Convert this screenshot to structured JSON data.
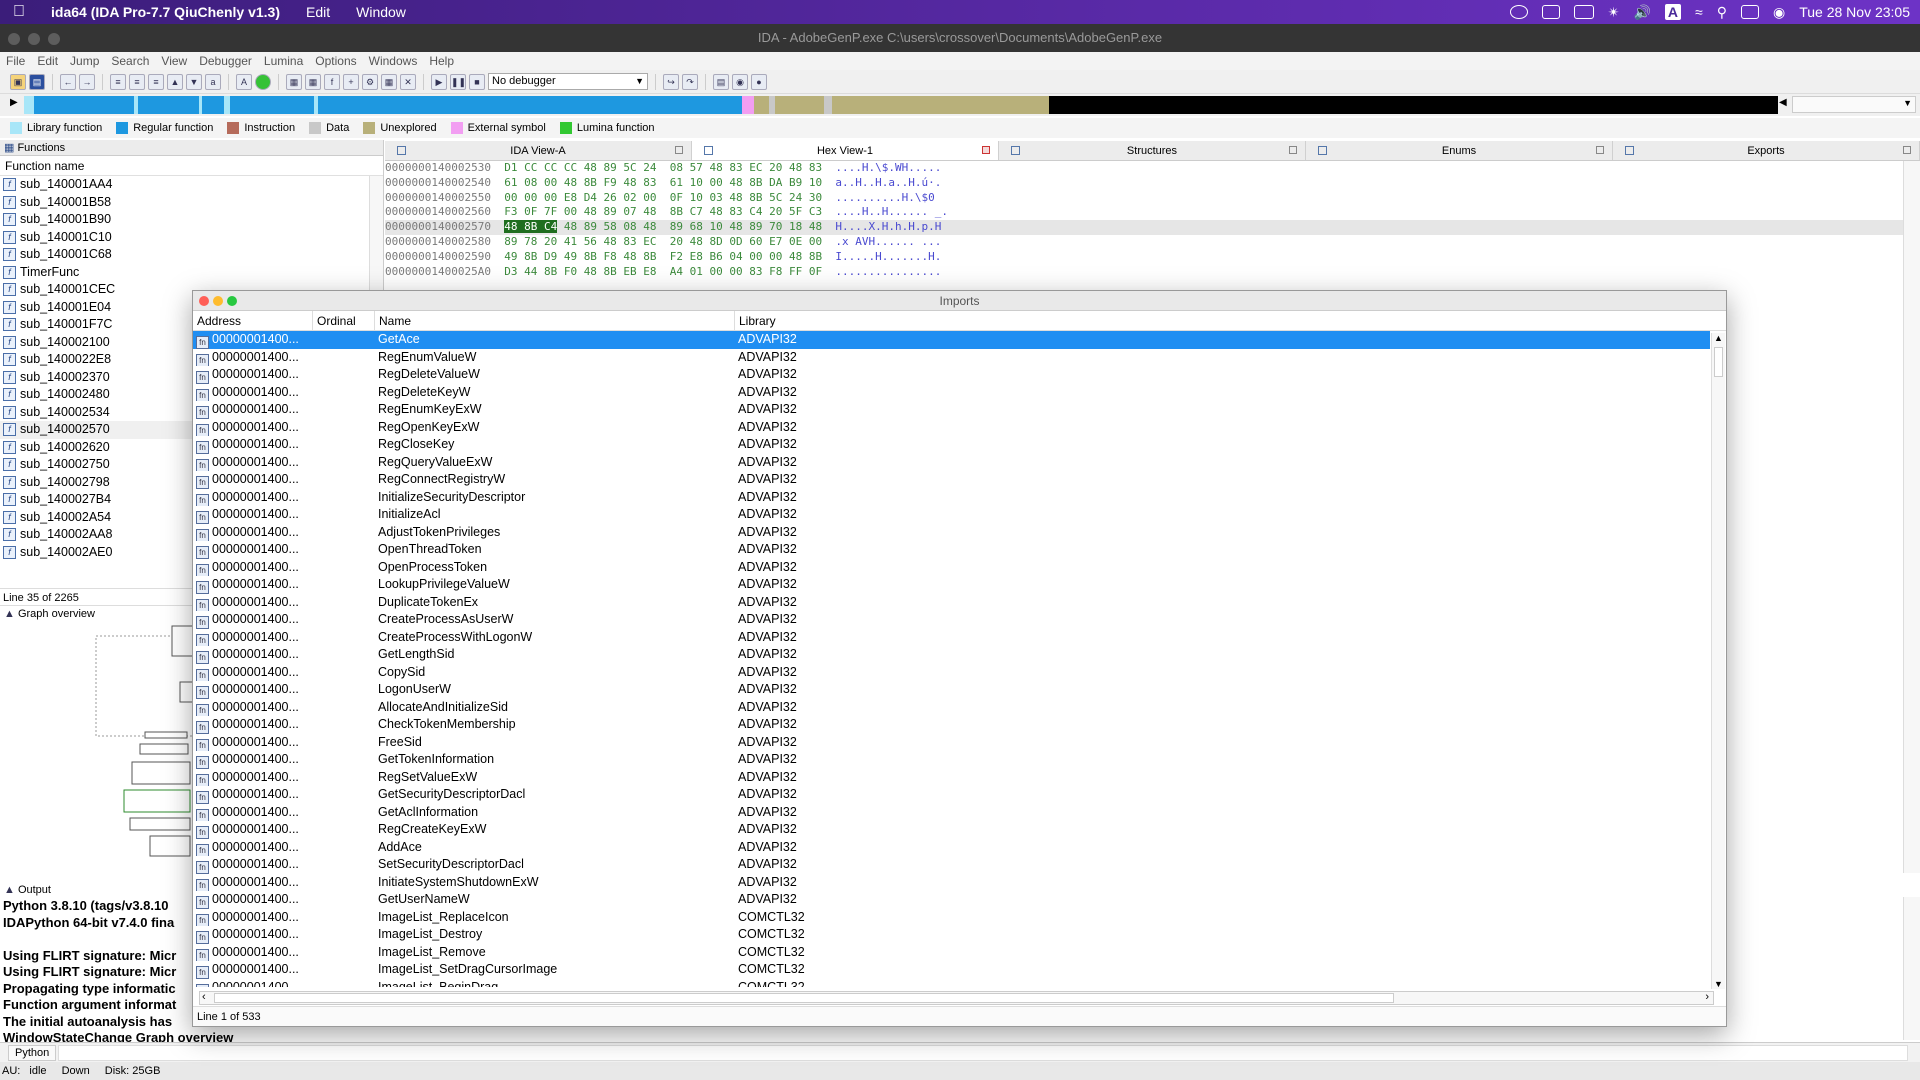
{
  "macbar": {
    "app": "ida64 (IDA Pro-7.7 QiuChenly v1.3)",
    "menus": [
      "Edit",
      "Window"
    ],
    "clock": "Tue 28 Nov  23:05"
  },
  "window": {
    "title": "IDA - AdobeGenP.exe C:\\users\\crossover\\Documents\\AdobeGenP.exe"
  },
  "menubar": [
    "File",
    "Edit",
    "Jump",
    "Search",
    "View",
    "Debugger",
    "Lumina",
    "Options",
    "Windows",
    "Help"
  ],
  "toolbar": {
    "debugger_select": "No debugger"
  },
  "legend": [
    {
      "label": "Library function",
      "color": "#a8e6f8"
    },
    {
      "label": "Regular function",
      "color": "#1e98e0"
    },
    {
      "label": "Instruction",
      "color": "#b56b5b"
    },
    {
      "label": "Data",
      "color": "#c8c8c8"
    },
    {
      "label": "Unexplored",
      "color": "#b8b07a"
    },
    {
      "label": "External symbol",
      "color": "#f29ef2"
    },
    {
      "label": "Lumina function",
      "color": "#32c832"
    }
  ],
  "functions": {
    "title": "Functions",
    "column": "Function name",
    "items": [
      "sub_140001AA4",
      "sub_140001B58",
      "sub_140001B90",
      "sub_140001C10",
      "sub_140001C68",
      "TimerFunc",
      "sub_140001CEC",
      "sub_140001E04",
      "sub_140001F7C",
      "sub_140002100",
      "sub_1400022E8",
      "sub_140002370",
      "sub_140002480",
      "sub_140002534",
      "sub_140002570",
      "sub_140002620",
      "sub_140002750",
      "sub_140002798",
      "sub_1400027B4",
      "sub_140002A54",
      "sub_140002AA8",
      "sub_140002AE0"
    ],
    "status": "Line 35 of 2265",
    "graph_title": "Graph overview"
  },
  "tabs": [
    {
      "label": "IDA View-A",
      "active": false
    },
    {
      "label": "Hex View-1",
      "active": true
    },
    {
      "label": "Structures",
      "active": false
    },
    {
      "label": "Enums",
      "active": false
    },
    {
      "label": "Exports",
      "active": false
    }
  ],
  "hex": [
    {
      "addr": "0000000140002530",
      "a": "D1 CC CC CC 48 89 5C 24",
      "b": "08 57 48 83 EC 20 48 83",
      "asc": "....H.\\$.WH....."
    },
    {
      "addr": "0000000140002540",
      "a": "61 08 00 48 8B F9 48 83",
      "b": "61 10 00 48 8B DA B9 10",
      "asc": "a..H..H.a..H.ú·."
    },
    {
      "addr": "0000000140002550",
      "a": "00 00 00 E8 D4 26 02 00",
      "b": "0F 10 03 48 8B 5C 24 30",
      "asc": "..........H.\\$0"
    },
    {
      "addr": "0000000140002560",
      "a": "F3 0F 7F 00 48 89 07 48",
      "b": "8B C7 48 83 C4 20 5F C3",
      "asc": "....H..H...... _."
    },
    {
      "addr": "0000000140002570",
      "a": "48 8B C4 48 89 58 08 48",
      "b": "89 68 10 48 89 70 18 48",
      "asc": "H....X.H.h.H.p.H",
      "sel": true
    },
    {
      "addr": "0000000140002580",
      "a": "89 78 20 41 56 48 83 EC",
      "b": "20 48 8D 0D 60 E7 0E 00",
      "asc": ".x AVH...... ..."
    },
    {
      "addr": "0000000140002590",
      "a": "49 8B D9 49 8B F8 48 8B",
      "b": "F2 E8 B6 04 00 00 48 8B",
      "asc": "I.....H.......H."
    },
    {
      "addr": "00000001400025A0",
      "a": "D3 44 8B F0 48 8B EB E8",
      "b": "A4 01 00 00 83 F8 FF 0F",
      "asc": "................"
    }
  ],
  "imports": {
    "title": "Imports",
    "columns": [
      "Address",
      "Ordinal",
      "Name",
      "Library"
    ],
    "addr_display": "00000001400...",
    "rows": [
      {
        "name": "GetAce",
        "lib": "ADVAPI32"
      },
      {
        "name": "RegEnumValueW",
        "lib": "ADVAPI32"
      },
      {
        "name": "RegDeleteValueW",
        "lib": "ADVAPI32"
      },
      {
        "name": "RegDeleteKeyW",
        "lib": "ADVAPI32"
      },
      {
        "name": "RegEnumKeyExW",
        "lib": "ADVAPI32"
      },
      {
        "name": "RegOpenKeyExW",
        "lib": "ADVAPI32"
      },
      {
        "name": "RegCloseKey",
        "lib": "ADVAPI32"
      },
      {
        "name": "RegQueryValueExW",
        "lib": "ADVAPI32"
      },
      {
        "name": "RegConnectRegistryW",
        "lib": "ADVAPI32"
      },
      {
        "name": "InitializeSecurityDescriptor",
        "lib": "ADVAPI32"
      },
      {
        "name": "InitializeAcl",
        "lib": "ADVAPI32"
      },
      {
        "name": "AdjustTokenPrivileges",
        "lib": "ADVAPI32"
      },
      {
        "name": "OpenThreadToken",
        "lib": "ADVAPI32"
      },
      {
        "name": "OpenProcessToken",
        "lib": "ADVAPI32"
      },
      {
        "name": "LookupPrivilegeValueW",
        "lib": "ADVAPI32"
      },
      {
        "name": "DuplicateTokenEx",
        "lib": "ADVAPI32"
      },
      {
        "name": "CreateProcessAsUserW",
        "lib": "ADVAPI32"
      },
      {
        "name": "CreateProcessWithLogonW",
        "lib": "ADVAPI32"
      },
      {
        "name": "GetLengthSid",
        "lib": "ADVAPI32"
      },
      {
        "name": "CopySid",
        "lib": "ADVAPI32"
      },
      {
        "name": "LogonUserW",
        "lib": "ADVAPI32"
      },
      {
        "name": "AllocateAndInitializeSid",
        "lib": "ADVAPI32"
      },
      {
        "name": "CheckTokenMembership",
        "lib": "ADVAPI32"
      },
      {
        "name": "FreeSid",
        "lib": "ADVAPI32"
      },
      {
        "name": "GetTokenInformation",
        "lib": "ADVAPI32"
      },
      {
        "name": "RegSetValueExW",
        "lib": "ADVAPI32"
      },
      {
        "name": "GetSecurityDescriptorDacl",
        "lib": "ADVAPI32"
      },
      {
        "name": "GetAclInformation",
        "lib": "ADVAPI32"
      },
      {
        "name": "RegCreateKeyExW",
        "lib": "ADVAPI32"
      },
      {
        "name": "AddAce",
        "lib": "ADVAPI32"
      },
      {
        "name": "SetSecurityDescriptorDacl",
        "lib": "ADVAPI32"
      },
      {
        "name": "InitiateSystemShutdownExW",
        "lib": "ADVAPI32"
      },
      {
        "name": "GetUserNameW",
        "lib": "ADVAPI32"
      },
      {
        "name": "ImageList_ReplaceIcon",
        "lib": "COMCTL32"
      },
      {
        "name": "ImageList_Destroy",
        "lib": "COMCTL32"
      },
      {
        "name": "ImageList_Remove",
        "lib": "COMCTL32"
      },
      {
        "name": "ImageList_SetDragCursorImage",
        "lib": "COMCTL32"
      },
      {
        "name": "ImageList_BeginDrag",
        "lib": "COMCTL32"
      }
    ],
    "status": "Line 1 of 533"
  },
  "output": {
    "title": "Output",
    "lines": [
      "Python 3.8.10 (tags/v3.8.10",
      "IDAPython 64-bit v7.4.0 fina",
      "",
      "Using FLIRT signature: Micr",
      "Using FLIRT signature: Micr",
      "Propagating type informatic",
      "Function argument informat",
      "The initial autoanalysis has",
      "WindowStateChange Graph overview"
    ]
  },
  "python_tab": "Python",
  "statusbar": {
    "au": "AU:",
    "state": "idle",
    "dir": "Down",
    "disk": "Disk: 25GB"
  }
}
